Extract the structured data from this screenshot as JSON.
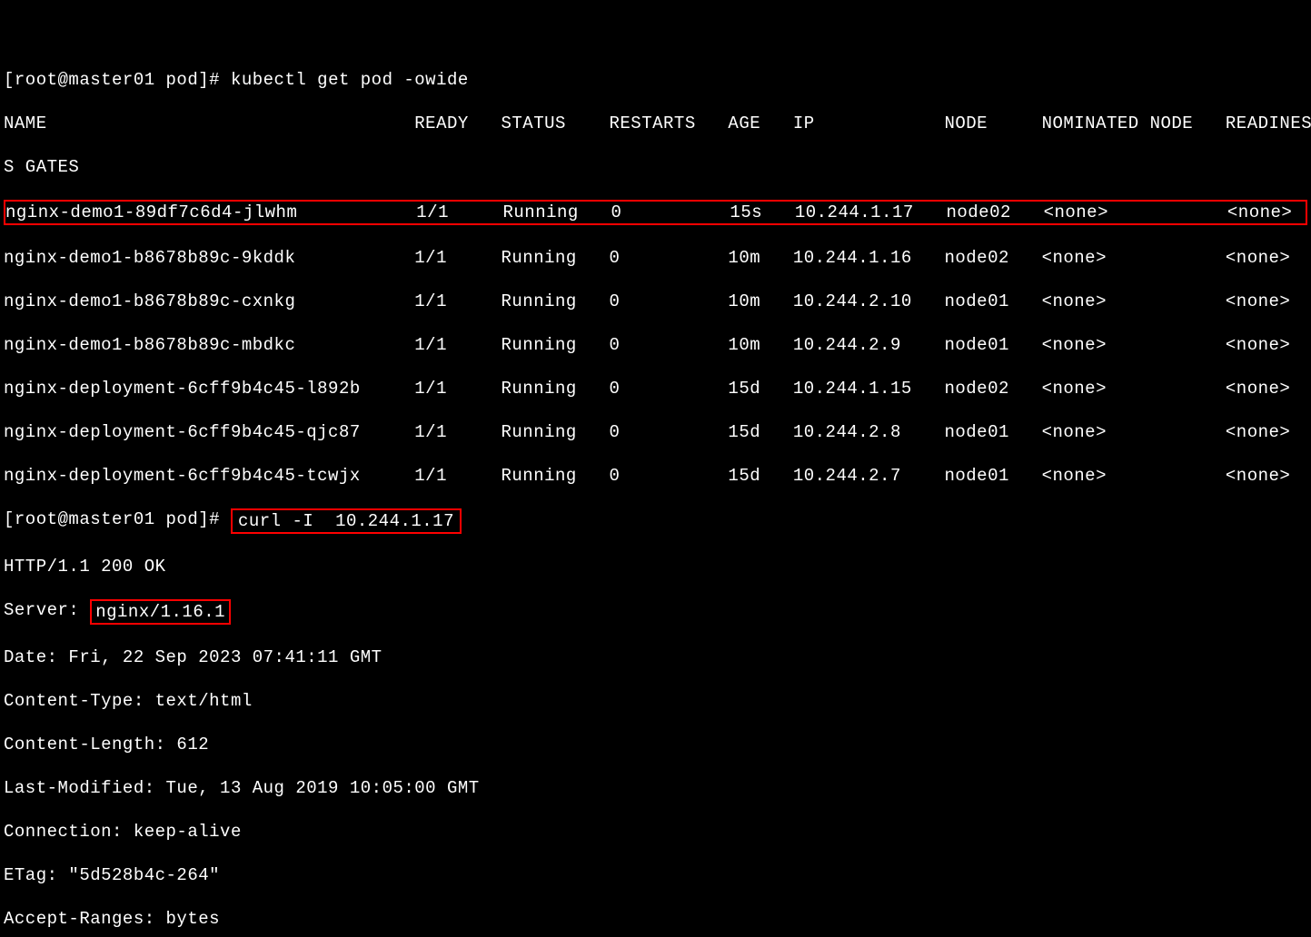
{
  "prompt1": "[root@master01 pod]# ",
  "cmd1": "kubectl get pod -owide",
  "header_line1": "NAME                                  READY   STATUS    RESTARTS   AGE   IP            NODE     NOMINATED NODE   READINES",
  "header_line2": "S GATES",
  "rows": [
    "nginx-demo1-89df7c6d4-jlwhm           1/1     Running   0          15s   10.244.1.17   node02   <none>           <none>",
    "nginx-demo1-b8678b89c-9kddk           1/1     Running   0          10m   10.244.1.16   node02   <none>           <none>",
    "nginx-demo1-b8678b89c-cxnkg           1/1     Running   0          10m   10.244.2.10   node01   <none>           <none>",
    "nginx-demo1-b8678b89c-mbdkc           1/1     Running   0          10m   10.244.2.9    node01   <none>           <none>",
    "nginx-deployment-6cff9b4c45-l892b     1/1     Running   0          15d   10.244.1.15   node02   <none>           <none>",
    "nginx-deployment-6cff9b4c45-qjc87     1/1     Running   0          15d   10.244.2.8    node01   <none>           <none>",
    "nginx-deployment-6cff9b4c45-tcwjx     1/1     Running   0          15d   10.244.2.7    node01   <none>           <none>"
  ],
  "prompt2": "[root@master01 pod]# ",
  "cmd2": "curl -I  10.244.1.17",
  "http_status": "HTTP/1.1 200 OK",
  "server_label": "Server: ",
  "server_value": "nginx/1.16.1",
  "headers": [
    "Date: Fri, 22 Sep 2023 07:41:11 GMT",
    "Content-Type: text/html",
    "Content-Length: 612",
    "Last-Modified: Tue, 13 Aug 2019 10:05:00 GMT",
    "Connection: keep-alive",
    "ETag: \"5d528b4c-264\"",
    "Accept-Ranges: bytes"
  ]
}
